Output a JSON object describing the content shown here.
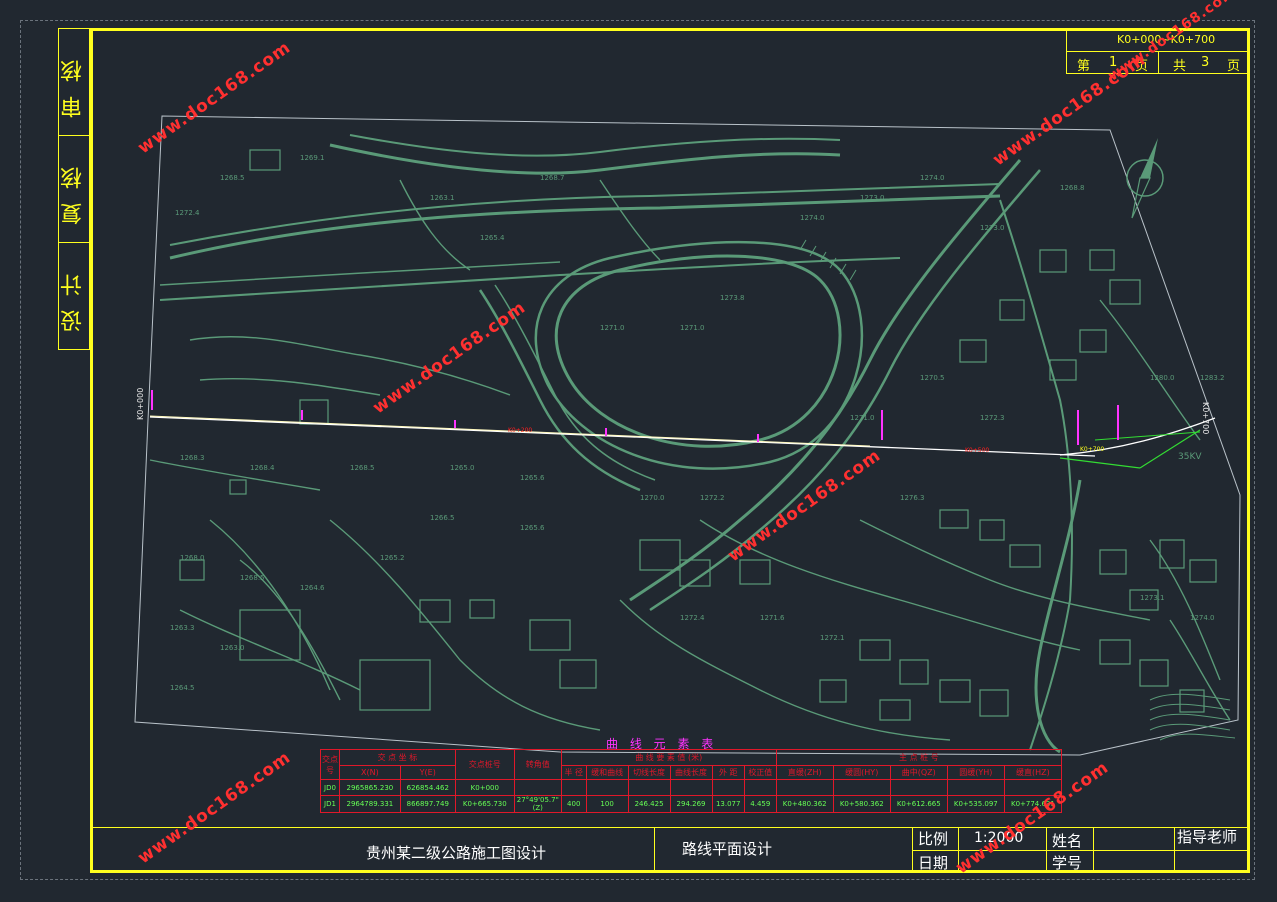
{
  "sidebar": {
    "cells": [
      "审核",
      "复核",
      "设计"
    ]
  },
  "title_block_top": {
    "range": "K0+000~K0+700",
    "page_prefix": "第",
    "page_num": "1",
    "page_suffix": "页",
    "total_prefix": "共",
    "total_num": "3",
    "total_suffix": "页"
  },
  "bottom": {
    "project": "贵州某二级公路施工图设计",
    "drawing": "路线平面设计",
    "scale_label": "比例",
    "scale_value": "1:2000",
    "date_label": "日期",
    "name_label": "姓名",
    "student_label": "学号",
    "teacher_label": "指导老师"
  },
  "map": {
    "start_station": "K0+000",
    "end_station": "K0+700",
    "label_right": "35KV",
    "label_yellow": "K0+700"
  },
  "curve_table": {
    "title": "曲 线 元 素 表",
    "headers": {
      "num": "交点号",
      "coord": "交 点 坐 标",
      "x": "X(N)",
      "y": "Y(E)",
      "station": "交点桩号",
      "angle": "转角值",
      "elements": "曲 线 要 素 值 (米)",
      "main": "主 点 桩 号",
      "radius": "半 径",
      "spiral": "缓和曲线",
      "tangent": "切线长度",
      "curve_len": "曲线长度",
      "external": "外 距",
      "correction": "校正值",
      "zh": "直缓(ZH)",
      "hy": "缓圆(HY)",
      "qz": "曲中(QZ)",
      "yh": "圆缓(YH)",
      "hz": "缓直(HZ)"
    },
    "rows": [
      {
        "num": "JD0",
        "x": "2965865.230",
        "y": "626854.462",
        "station": "K0+000",
        "angle": "",
        "r": "",
        "ls": "",
        "t": "",
        "l": "",
        "e": "",
        "j": "",
        "zh": "",
        "hy": "",
        "qz": "",
        "yh": "",
        "hz": ""
      },
      {
        "num": "JD1",
        "x": "2964789.331",
        "y": "866897.749",
        "station": "K0+665.730",
        "angle": "27°49'05.7\"(Z)",
        "r": "400",
        "ls": "100",
        "t": "246.425",
        "l": "294.269",
        "e": "13.077",
        "j": "4.459",
        "zh": "K0+480.362",
        "hy": "K0+580.362",
        "qz": "K0+612.665",
        "yh": "K0+535.097",
        "hz": "K0+774.631"
      }
    ]
  },
  "watermark": "www.doc168.com"
}
